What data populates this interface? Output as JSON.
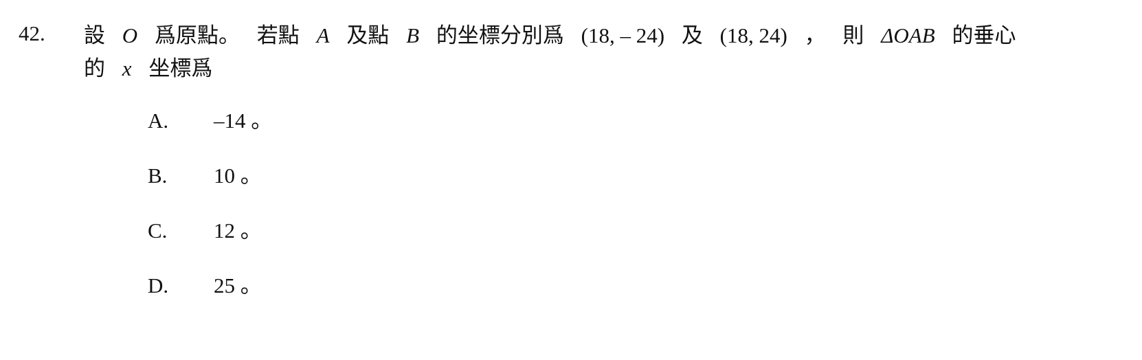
{
  "question": {
    "number": "42.",
    "line1": [
      {
        "t": "設",
        "m": false
      },
      {
        "t": "O",
        "m": true
      },
      {
        "t": "爲原點。",
        "m": false
      },
      {
        "t": "若點",
        "m": false
      },
      {
        "t": "A",
        "m": true
      },
      {
        "t": "及點",
        "m": false
      },
      {
        "t": "B",
        "m": true
      },
      {
        "t": "的坐標分別爲",
        "m": false
      },
      {
        "t": "(18, – 24)",
        "m": false
      },
      {
        "t": "及",
        "m": false
      },
      {
        "t": "(18, 24)",
        "m": false
      },
      {
        "t": "，",
        "m": false
      },
      {
        "t": "則",
        "m": false
      },
      {
        "t": "ΔOAB",
        "m": true
      },
      {
        "t": "的垂心",
        "m": false
      }
    ],
    "line2": [
      {
        "t": "的",
        "m": false
      },
      {
        "t": "x",
        "m": true
      },
      {
        "t": "坐標爲",
        "m": false
      }
    ]
  },
  "options": [
    {
      "label": "A.",
      "text": "–14 。"
    },
    {
      "label": "B.",
      "text": "10 。"
    },
    {
      "label": "C.",
      "text": "12 。"
    },
    {
      "label": "D.",
      "text": "25 。"
    }
  ]
}
